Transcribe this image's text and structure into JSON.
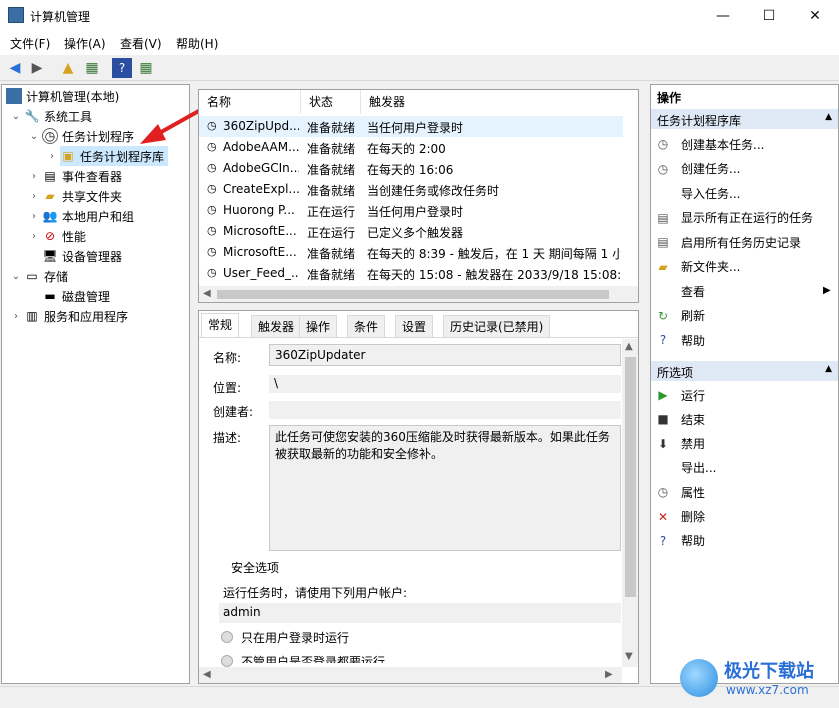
{
  "window": {
    "title": "计算机管理",
    "minimize": "—",
    "maximize": "☐",
    "close": "✕"
  },
  "menu": [
    "文件(F)",
    "操作(A)",
    "查看(V)",
    "帮助(H)"
  ],
  "tree": {
    "root": "计算机管理(本地)",
    "system_tools": "系统工具",
    "task_scheduler": "任务计划程序",
    "task_library": "任务计划程序库",
    "event_viewer": "事件查看器",
    "shared_folders": "共享文件夹",
    "local_users": "本地用户和组",
    "performance": "性能",
    "device_manager": "设备管理器",
    "storage": "存储",
    "disk_management": "磁盘管理",
    "services": "服务和应用程序"
  },
  "tasklist": {
    "headers": [
      "名称",
      "状态",
      "触发器"
    ],
    "rows": [
      {
        "name": "360ZipUpd...",
        "status": "准备就绪",
        "trigger": "当任何用户登录时"
      },
      {
        "name": "AdobeAAM...",
        "status": "准备就绪",
        "trigger": "在每天的 2:00"
      },
      {
        "name": "AdobeGCIn...",
        "status": "准备就绪",
        "trigger": "在每天的 16:06"
      },
      {
        "name": "CreateExpl...",
        "status": "准备就绪",
        "trigger": "当创建任务或修改任务时"
      },
      {
        "name": "Huorong P...",
        "status": "正在运行",
        "trigger": "当任何用户登录时"
      },
      {
        "name": "MicrosoftE...",
        "status": "正在运行",
        "trigger": "已定义多个触发器"
      },
      {
        "name": "MicrosoftE...",
        "status": "准备就绪",
        "trigger": "在每天的 8:39 - 触发后，在 1 天 期间每隔 1 小"
      },
      {
        "name": "User_Feed_...",
        "status": "准备就绪",
        "trigger": "在每天的 15:08 - 触发器在 2033/9/18 15:08:5"
      }
    ]
  },
  "props": {
    "tabs": [
      "常规",
      "触发器",
      "操作",
      "条件",
      "设置",
      "历史记录(已禁用)"
    ],
    "name_label": "名称:",
    "name_value": "360ZipUpdater",
    "location_label": "位置:",
    "location_value": "\\",
    "author_label": "创建者:",
    "desc_label": "描述:",
    "desc_value": "此任务可使您安装的360压缩能及时获得最新版本。如果此任务被获取最新的功能和安全修补。",
    "security_label": "安全选项",
    "run_as_label": "运行任务时，请使用下列用户帐户:",
    "run_as_value": "admin",
    "opt1": "只在用户登录时运行",
    "opt2": "不管用户是否登录都要运行"
  },
  "actions": {
    "header": "操作",
    "section1": "任务计划程序库",
    "items1": [
      "创建基本任务...",
      "创建任务...",
      "导入任务...",
      "显示所有正在运行的任务",
      "启用所有任务历史记录",
      "新文件夹...",
      "查看",
      "刷新",
      "帮助"
    ],
    "section2": "所选项",
    "items2": [
      "运行",
      "结束",
      "禁用",
      "导出...",
      "属性",
      "删除",
      "帮助"
    ]
  },
  "watermark": {
    "brand": "极光下载站",
    "url": "www.xz7.com"
  }
}
